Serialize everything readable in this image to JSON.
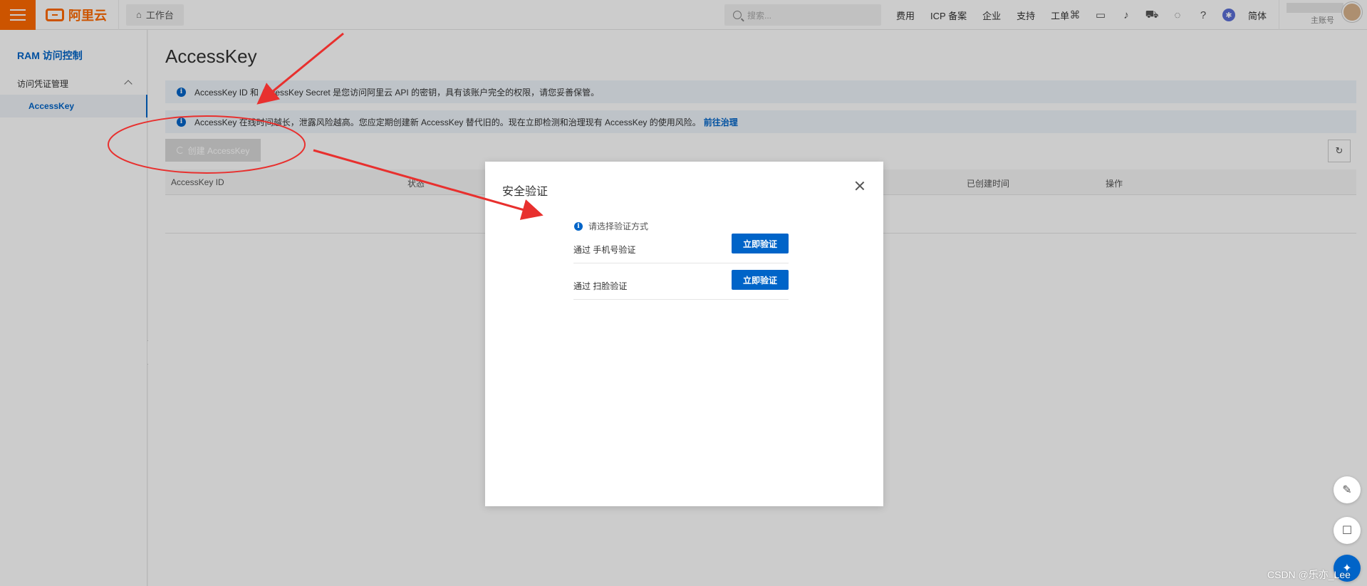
{
  "topbar": {
    "brand": "阿里云",
    "workbench_label": "工作台",
    "search_placeholder": "搜索...",
    "links": [
      "费用",
      "ICP 备案",
      "企业",
      "支持",
      "工单"
    ],
    "lang": "简体",
    "account_label": "主账号"
  },
  "sidebar": {
    "product": "RAM 访问控制",
    "group_label": "访问凭证管理",
    "active_item": "AccessKey"
  },
  "main": {
    "title": "AccessKey",
    "notice1": "AccessKey ID 和 AccessKey Secret 是您访问阿里云 API 的密钥，具有该账户完全的权限，请您妥善保管。",
    "notice2": "AccessKey 在线时间越长，泄露风险越高。您应定期创建新 AccessKey 替代旧的。现在立即检测和治理现有 AccessKey 的使用风险。",
    "notice2_link": "前往治理",
    "create_button": "创建 AccessKey",
    "columns": [
      "AccessKey ID",
      "状态",
      "已创建时间",
      "操作"
    ]
  },
  "modal": {
    "title": "安全验证",
    "hint": "请选择验证方式",
    "options": [
      {
        "label": "通过 手机号验证",
        "button": "立即验证"
      },
      {
        "label": "通过 扫脸验证",
        "button": "立即验证"
      }
    ]
  },
  "watermark": "CSDN @乐亦_Lee",
  "colors": {
    "accent": "#0064c8",
    "brand": "#ff6a00",
    "annotation": "#e8302e"
  }
}
